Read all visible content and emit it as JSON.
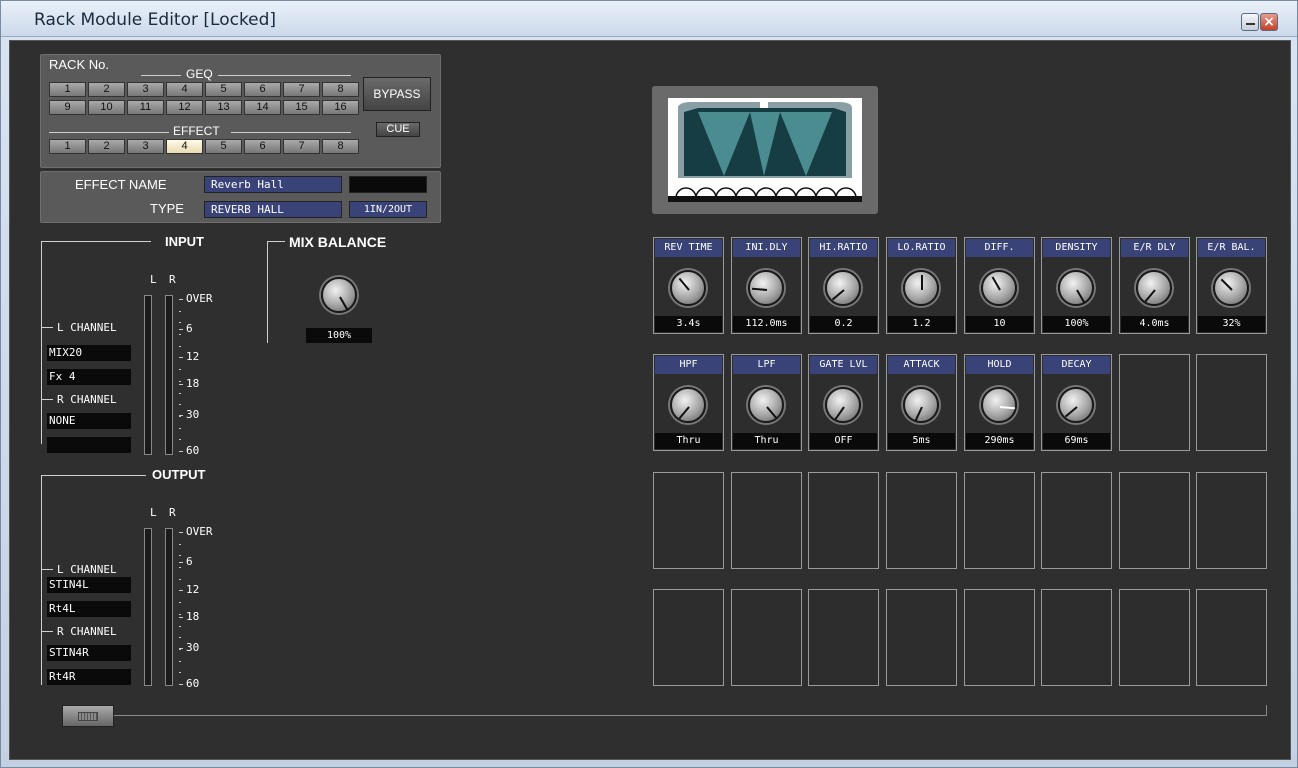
{
  "window": {
    "title": "Rack Module Editor [Locked]",
    "close_glyph": "×"
  },
  "rack": {
    "label": "RACK No.",
    "geq_label": "GEQ",
    "effect_label": "EFFECT",
    "geq_row1": [
      "1",
      "2",
      "3",
      "4",
      "5",
      "6",
      "7",
      "8"
    ],
    "geq_row2": [
      "9",
      "10",
      "11",
      "12",
      "13",
      "14",
      "15",
      "16"
    ],
    "effect_row": [
      "1",
      "2",
      "3",
      "4",
      "5",
      "6",
      "7",
      "8"
    ],
    "selected_effect": "4",
    "bypass": "BYPASS",
    "cue": "CUE"
  },
  "effect": {
    "name_label": "EFFECT NAME",
    "name_value": "Reverb Hall",
    "type_label": "TYPE",
    "type_value": "REVERB HALL",
    "io": "1IN/2OUT"
  },
  "input": {
    "title": "INPUT",
    "l": "L",
    "r": "R",
    "l_channel": "L CHANNEL",
    "l_src1": "MIX20",
    "l_src2": "Fx 4",
    "r_channel": "R CHANNEL",
    "r_src1": "NONE",
    "r_src2": "",
    "scale": [
      "OVER",
      "6",
      "12",
      "18",
      "30",
      "60"
    ]
  },
  "mix": {
    "title": "MIX BALANCE",
    "value": "100%"
  },
  "output": {
    "title": "OUTPUT",
    "l": "L",
    "r": "R",
    "l_channel": "L CHANNEL",
    "l_dst1": "STIN4L",
    "l_dst2": "Rt4L",
    "r_channel": "R CHANNEL",
    "r_dst1": "STIN4R",
    "r_dst2": "Rt4R",
    "scale": [
      "OVER",
      "6",
      "12",
      "18",
      "30",
      "60"
    ]
  },
  "params_row1": [
    {
      "label": "REV TIME",
      "value": "3.4s",
      "angle": -40
    },
    {
      "label": "INI.DLY",
      "value": "112.0ms",
      "angle": -85
    },
    {
      "label": "HI.RATIO",
      "value": "0.2",
      "angle": -130
    },
    {
      "label": "LO.RATIO",
      "value": "1.2",
      "angle": 0
    },
    {
      "label": "DIFF.",
      "value": "10",
      "angle": -30
    },
    {
      "label": "DENSITY",
      "value": "100%",
      "angle": 150
    },
    {
      "label": "E/R DLY",
      "value": "4.0ms",
      "angle": -140
    },
    {
      "label": "E/R BAL.",
      "value": "32%",
      "angle": -45
    }
  ],
  "params_row2": [
    {
      "label": "HPF",
      "value": "Thru",
      "angle": -140
    },
    {
      "label": "LPF",
      "value": "Thru",
      "angle": 140
    },
    {
      "label": "GATE LVL",
      "value": "OFF",
      "angle": -145
    },
    {
      "label": "ATTACK",
      "value": "5ms",
      "angle": -155
    },
    {
      "label": "HOLD",
      "value": "290ms",
      "angle": 95
    },
    {
      "label": "DECAY",
      "value": "69ms",
      "angle": -130
    }
  ],
  "icons": {
    "min": "minimize-icon",
    "close": "close-icon",
    "hall": "reverb-hall-icon",
    "slider": "scroll-thumb-icon"
  }
}
